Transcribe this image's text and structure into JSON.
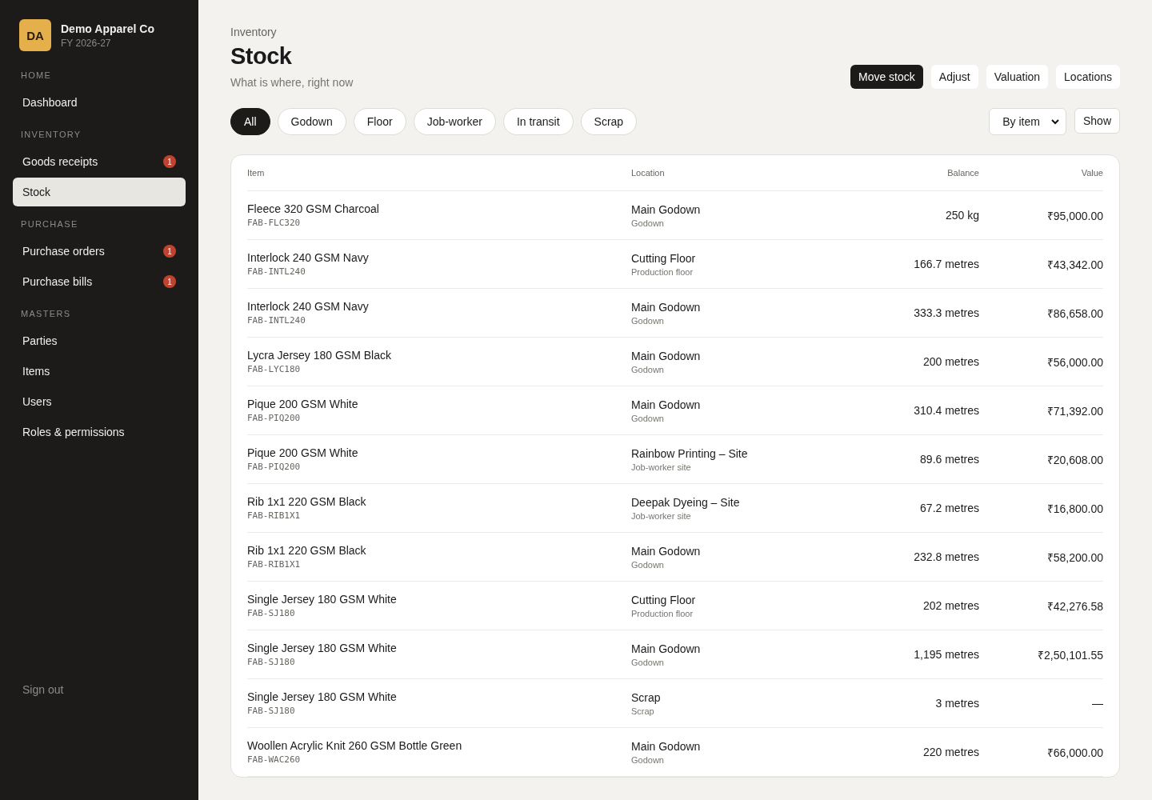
{
  "company": {
    "initials": "DA",
    "name": "Demo Apparel Co",
    "year": "FY 2026-27"
  },
  "sidebar": {
    "sections": [
      {
        "heading": "HOME",
        "items": [
          {
            "label": "Dashboard",
            "selected": false
          }
        ]
      },
      {
        "heading": "INVENTORY",
        "items": [
          {
            "label": "Goods receipts",
            "badge": "1",
            "selected": false
          },
          {
            "label": "Stock",
            "selected": true
          }
        ]
      },
      {
        "heading": "PURCHASE",
        "items": [
          {
            "label": "Purchase orders",
            "badge": "1",
            "selected": false
          },
          {
            "label": "Purchase bills",
            "badge": "1",
            "selected": false
          }
        ]
      },
      {
        "heading": "MASTERS",
        "items": [
          {
            "label": "Parties",
            "selected": false
          },
          {
            "label": "Items",
            "selected": false
          },
          {
            "label": "Users",
            "selected": false
          },
          {
            "label": "Roles & permissions",
            "selected": false
          }
        ]
      }
    ],
    "sign_out": "Sign out"
  },
  "header": {
    "breadcrumb": "Inventory",
    "title": "Stock",
    "subtitle": "What is where, right now"
  },
  "actions": [
    {
      "label": "Move stock",
      "primary": true
    },
    {
      "label": "Adjust",
      "primary": false
    },
    {
      "label": "Valuation",
      "primary": false
    },
    {
      "label": "Locations",
      "primary": false
    }
  ],
  "filters": [
    {
      "label": "All",
      "selected": true
    },
    {
      "label": "Godown",
      "selected": false
    },
    {
      "label": "Floor",
      "selected": false
    },
    {
      "label": "Job-worker",
      "selected": false
    },
    {
      "label": "In transit",
      "selected": false
    },
    {
      "label": "Scrap",
      "selected": false
    }
  ],
  "group_by": {
    "value": "By item"
  },
  "show_button": "Show",
  "table": {
    "columns": [
      "Item",
      "Location",
      "Balance",
      "Value"
    ],
    "rows": [
      {
        "item": "Fleece 320 GSM Charcoal",
        "code": "FAB-FLC320",
        "location": "Main Godown",
        "location_type": "Godown",
        "balance": "250 kg",
        "value": "₹95,000.00"
      },
      {
        "item": "Interlock 240 GSM Navy",
        "code": "FAB-INTL240",
        "location": "Cutting Floor",
        "location_type": "Production floor",
        "balance": "166.7 metres",
        "value": "₹43,342.00"
      },
      {
        "item": "Interlock 240 GSM Navy",
        "code": "FAB-INTL240",
        "location": "Main Godown",
        "location_type": "Godown",
        "balance": "333.3 metres",
        "value": "₹86,658.00"
      },
      {
        "item": "Lycra Jersey 180 GSM Black",
        "code": "FAB-LYC180",
        "location": "Main Godown",
        "location_type": "Godown",
        "balance": "200 metres",
        "value": "₹56,000.00"
      },
      {
        "item": "Pique 200 GSM White",
        "code": "FAB-PIQ200",
        "location": "Main Godown",
        "location_type": "Godown",
        "balance": "310.4 metres",
        "value": "₹71,392.00"
      },
      {
        "item": "Pique 200 GSM White",
        "code": "FAB-PIQ200",
        "location": "Rainbow Printing – Site",
        "location_type": "Job-worker site",
        "balance": "89.6 metres",
        "value": "₹20,608.00"
      },
      {
        "item": "Rib 1x1 220 GSM Black",
        "code": "FAB-RIB1X1",
        "location": "Deepak Dyeing – Site",
        "location_type": "Job-worker site",
        "balance": "67.2 metres",
        "value": "₹16,800.00"
      },
      {
        "item": "Rib 1x1 220 GSM Black",
        "code": "FAB-RIB1X1",
        "location": "Main Godown",
        "location_type": "Godown",
        "balance": "232.8 metres",
        "value": "₹58,200.00"
      },
      {
        "item": "Single Jersey 180 GSM White",
        "code": "FAB-SJ180",
        "location": "Cutting Floor",
        "location_type": "Production floor",
        "balance": "202 metres",
        "value": "₹42,276.58"
      },
      {
        "item": "Single Jersey 180 GSM White",
        "code": "FAB-SJ180",
        "location": "Main Godown",
        "location_type": "Godown",
        "balance": "1,195 metres",
        "value": "₹2,50,101.55"
      },
      {
        "item": "Single Jersey 180 GSM White",
        "code": "FAB-SJ180",
        "location": "Scrap",
        "location_type": "Scrap",
        "balance": "3 metres",
        "value": "—"
      },
      {
        "item": "Woollen Acrylic Knit 260 GSM Bottle Green",
        "code": "FAB-WAC260",
        "location": "Main Godown",
        "location_type": "Godown",
        "balance": "220 metres",
        "value": "₹66,000.00"
      }
    ]
  }
}
